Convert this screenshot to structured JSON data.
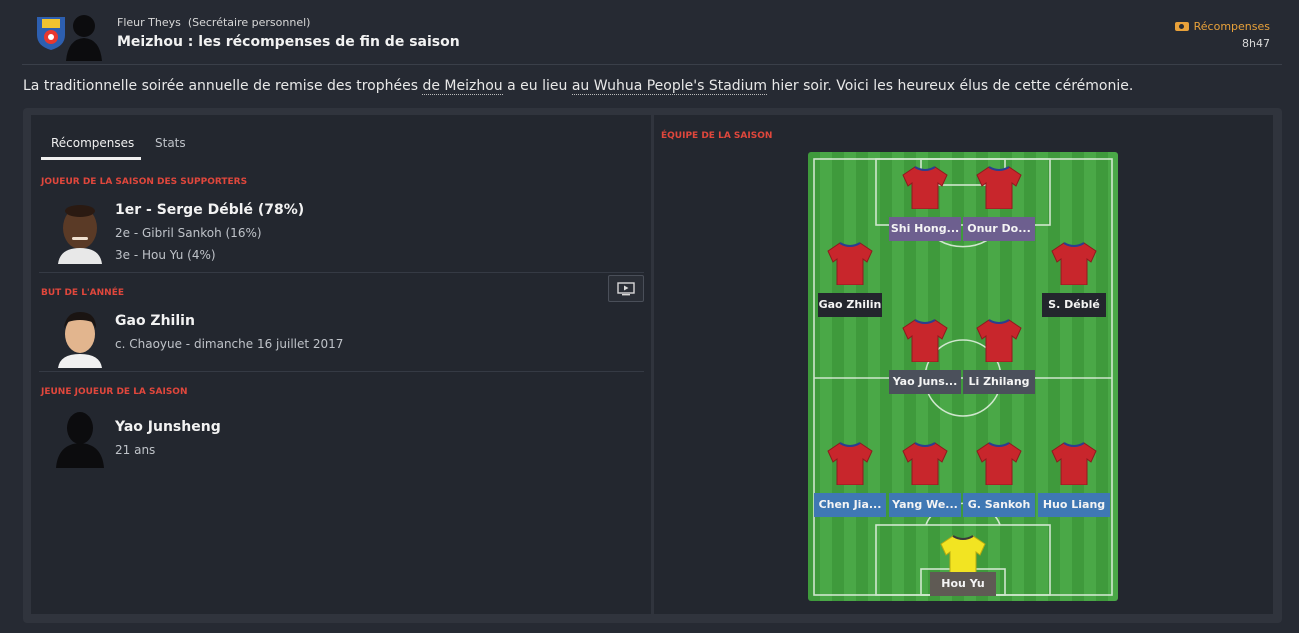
{
  "header": {
    "sender_name": "Fleur Theys",
    "sender_role": "(Secrétaire personnel)",
    "subject": "Meizhou : les récompenses de fin de saison",
    "tag_label": "Récompenses",
    "time": "8h47"
  },
  "intro": {
    "part1": "La traditionnelle soirée annuelle de remise des trophées ",
    "club_link": "de Meizhou",
    "part2": " a eu lieu ",
    "stadium_link": "au Wuhua People's Stadium",
    "part3": " hier soir. Voici les heureux élus de cette cérémonie."
  },
  "tabs": [
    "Récompenses",
    "Stats"
  ],
  "awards": {
    "fans_player": {
      "label": "Joueur de la saison des supporters",
      "first": "1er - Serge Déblé (78%)",
      "second": "2e - Gibril Sankoh (16%)",
      "third": "3e - Hou Yu (4%)"
    },
    "goal_of_year": {
      "label": "But de l'année",
      "name": "Gao Zhilin",
      "detail": "c. Chaoyue - dimanche 16 juillet 2017"
    },
    "young_player": {
      "label": "Jeune joueur de la saison",
      "name": "Yao Junsheng",
      "age": "21 ans"
    }
  },
  "team_of_season": {
    "label": "Équipe de la saison",
    "players": {
      "fw1": "Shi Hong...",
      "fw2": "Onur Do...",
      "lw": "Gao Zhilin",
      "rw": "S. Déblé",
      "cm1": "Yao Juns...",
      "cm2": "Li Zhilang",
      "df1": "Chen Jia...",
      "df2": "Yang We...",
      "df3": "G. Sankoh",
      "df4": "Huo Liang",
      "gk": "Hou Yu"
    }
  },
  "colors": {
    "accent_red": "#e0473c",
    "tag_orange": "#e8a13a",
    "shirt_red": "#c8262c",
    "gk_yellow": "#f2e422"
  }
}
